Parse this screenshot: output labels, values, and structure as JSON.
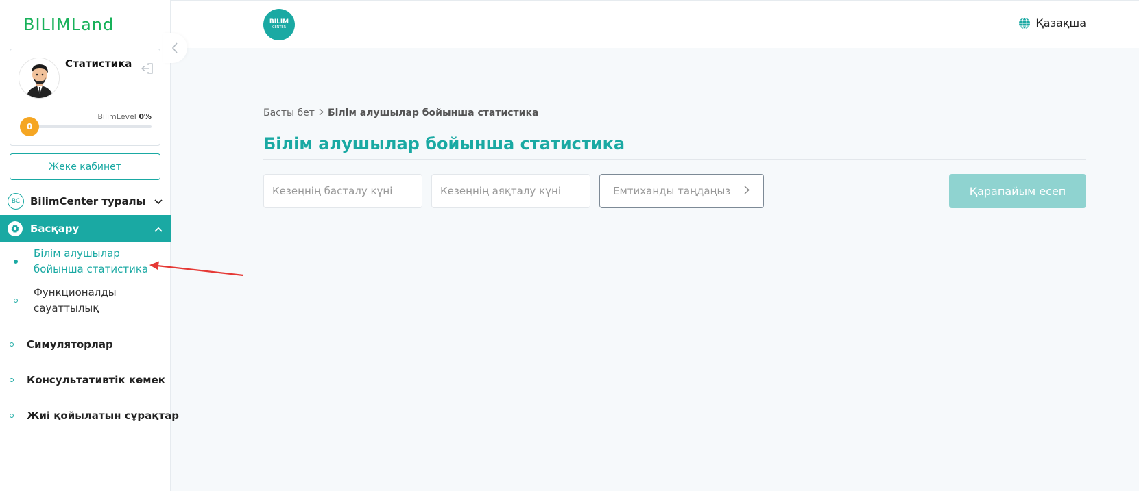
{
  "sidebar": {
    "logo": "BILIMLand",
    "profile": {
      "name": "Статистика",
      "level_label": "BilimLevel",
      "level_value": "0%",
      "level_progress": 0,
      "level_badge": "0"
    },
    "cabinet_button": "Жеке кабинет",
    "about": {
      "badge": "BC",
      "label": "BilimCenter туралы"
    },
    "admin": {
      "label": "Басқару",
      "items": [
        {
          "label": "Білім алушылар бойынша статистика",
          "active": true
        },
        {
          "label": "Функционалды сауаттылық",
          "active": false
        }
      ]
    },
    "items": [
      {
        "label": "Симуляторлар"
      },
      {
        "label": "Консультативтік көмек"
      },
      {
        "label": "Жиі қойылатын сұрақтар"
      }
    ]
  },
  "header": {
    "center_logo": {
      "line1": "BILIM",
      "line2": "CENTER"
    },
    "language": "Қазақша"
  },
  "main": {
    "breadcrumb": {
      "home": "Басты бет",
      "current": "Білім алушылар бойынша статистика"
    },
    "title": "Білім алушылар бойынша статистика",
    "filters": {
      "start_placeholder": "Кезеңнің басталу күні",
      "end_placeholder": "Кезеңнің аяқталу күні",
      "exam_placeholder": "Емтиханды таңдаңыз"
    },
    "report_button": "Қарапайым есеп"
  },
  "colors": {
    "accent": "#1aa9a3",
    "logo_green": "#18b15a",
    "level_orange": "#f5a623",
    "annotation_arrow": "#e53935"
  }
}
